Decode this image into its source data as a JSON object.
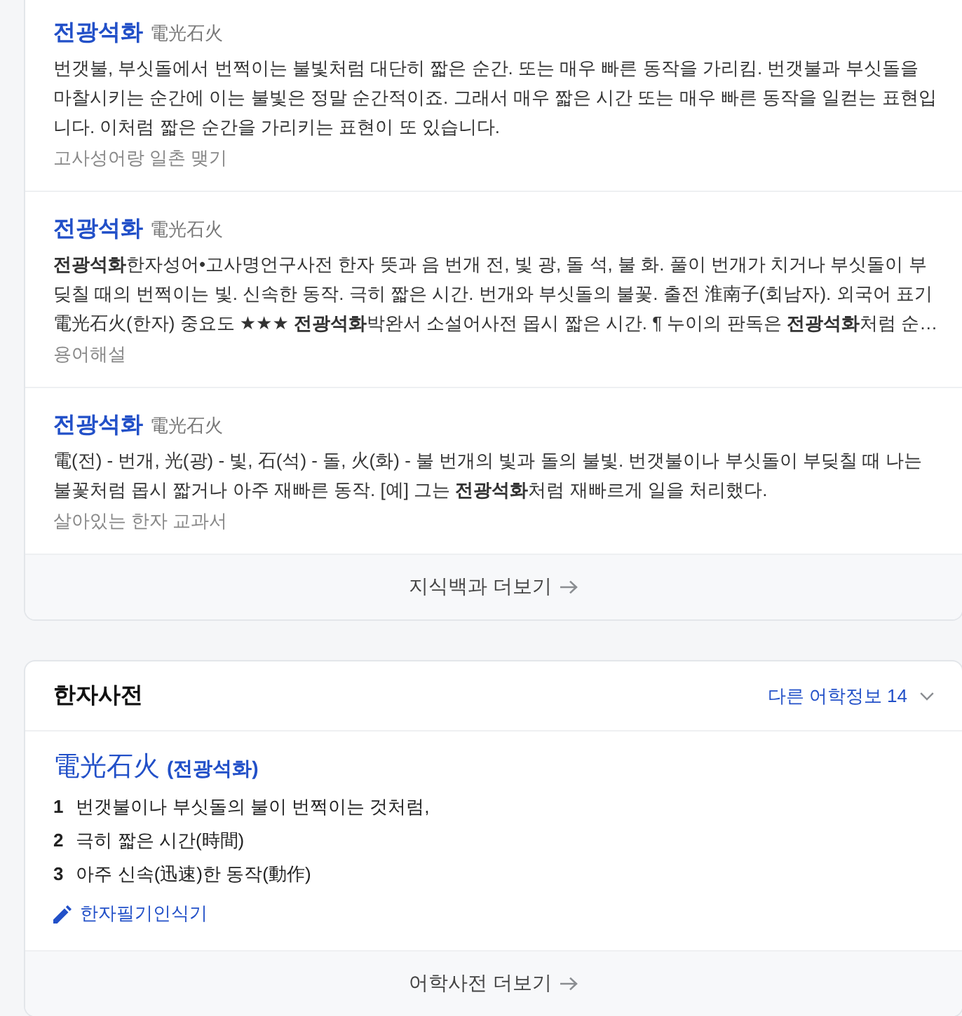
{
  "knowledge_card": {
    "entries": [
      {
        "title": "전광석화",
        "hanja": "電光石火",
        "body": "번갯불, 부싯돌에서 번쩍이는 불빛처럼 대단히 짧은 순간. 또는 매우 빠른 동작을 가리킴. 번갯불과 부싯돌을 마찰시키는 순간에 이는 불빛은 정말 순간적이죠. 그래서 매우 짧은 시간 또는 매우 빠른 동작을 일컫는 표현입니다. 이처럼 짧은 순간을 가리키는 표현이 또 있습니다.",
        "source": "고사성어랑 일촌 맺기"
      },
      {
        "title": "전광석화",
        "hanja": "電光石火",
        "body": "**전광석화**한자성어•고사명언구사전 한자 뜻과 음 번개 전, 빛 광, 돌 석, 불 화. 풀이 번개가 치거나 부싯돌이 부딪칠 때의 번쩍이는 빛. 신속한 동작. 극히 짧은 시간. 번개와 부싯돌의 불꽃. 출전 淮南子(회남자). 외국어 표기 電光石火(한자) 중요도 ★★★ **전광석화**박완서 소설어사전 몹시 짧은 시간. ¶ 누이의 판독은 **전광석화**처럼 순…",
        "source": "용어해설"
      },
      {
        "title": "전광석화",
        "hanja": "電光石火",
        "body": "電(전) - 번개, 光(광) - 빛, 石(석) - 돌, 火(화) - 불 번개의 빛과 돌의 불빛. 번갯불이나 부싯돌이 부딪칠 때 나는 불꽃처럼 몹시 짧거나 아주 재빠른 동작. [예] 그는 **전광석화**처럼 재빠르게 일을 처리했다.",
        "source": "살아있는 한자 교과서"
      }
    ],
    "more_link": "지식백과 더보기"
  },
  "hanja_dictionary": {
    "title": "한자사전",
    "other_info": "다른 어학정보 14",
    "word": "電光石火",
    "reading": "(전광석화)",
    "meanings": [
      {
        "number": "1",
        "text": "번갯불이나 부싯돌의 불이 번쩍이는 것처럼,"
      },
      {
        "number": "2",
        "text": "극히 짧은 시간(時間)"
      },
      {
        "number": "3",
        "text": "아주 신속(迅速)한 동작(動作)"
      }
    ],
    "handwriting_link": "한자필기인식기",
    "more_link": "어학사전 더보기"
  }
}
